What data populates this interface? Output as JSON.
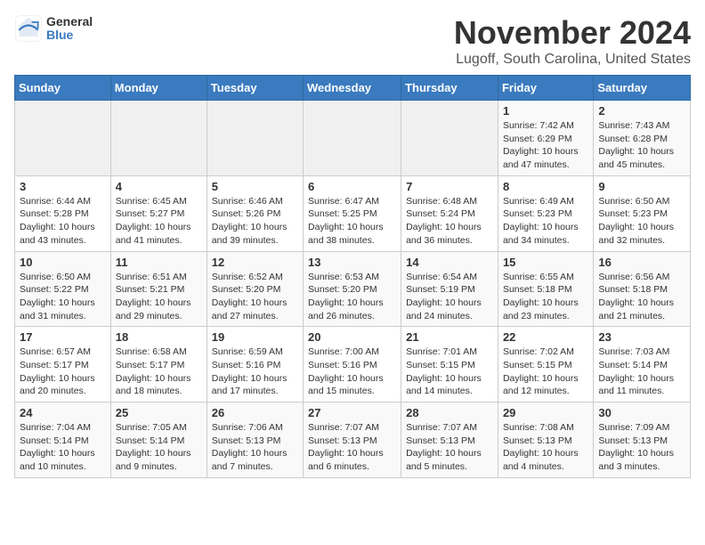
{
  "header": {
    "logo_general": "General",
    "logo_blue": "Blue",
    "title": "November 2024",
    "location": "Lugoff, South Carolina, United States"
  },
  "days_of_week": [
    "Sunday",
    "Monday",
    "Tuesday",
    "Wednesday",
    "Thursday",
    "Friday",
    "Saturday"
  ],
  "weeks": [
    [
      {
        "day": "",
        "info": ""
      },
      {
        "day": "",
        "info": ""
      },
      {
        "day": "",
        "info": ""
      },
      {
        "day": "",
        "info": ""
      },
      {
        "day": "",
        "info": ""
      },
      {
        "day": "1",
        "info": "Sunrise: 7:42 AM\nSunset: 6:29 PM\nDaylight: 10 hours\nand 47 minutes."
      },
      {
        "day": "2",
        "info": "Sunrise: 7:43 AM\nSunset: 6:28 PM\nDaylight: 10 hours\nand 45 minutes."
      }
    ],
    [
      {
        "day": "3",
        "info": "Sunrise: 6:44 AM\nSunset: 5:28 PM\nDaylight: 10 hours\nand 43 minutes."
      },
      {
        "day": "4",
        "info": "Sunrise: 6:45 AM\nSunset: 5:27 PM\nDaylight: 10 hours\nand 41 minutes."
      },
      {
        "day": "5",
        "info": "Sunrise: 6:46 AM\nSunset: 5:26 PM\nDaylight: 10 hours\nand 39 minutes."
      },
      {
        "day": "6",
        "info": "Sunrise: 6:47 AM\nSunset: 5:25 PM\nDaylight: 10 hours\nand 38 minutes."
      },
      {
        "day": "7",
        "info": "Sunrise: 6:48 AM\nSunset: 5:24 PM\nDaylight: 10 hours\nand 36 minutes."
      },
      {
        "day": "8",
        "info": "Sunrise: 6:49 AM\nSunset: 5:23 PM\nDaylight: 10 hours\nand 34 minutes."
      },
      {
        "day": "9",
        "info": "Sunrise: 6:50 AM\nSunset: 5:23 PM\nDaylight: 10 hours\nand 32 minutes."
      }
    ],
    [
      {
        "day": "10",
        "info": "Sunrise: 6:50 AM\nSunset: 5:22 PM\nDaylight: 10 hours\nand 31 minutes."
      },
      {
        "day": "11",
        "info": "Sunrise: 6:51 AM\nSunset: 5:21 PM\nDaylight: 10 hours\nand 29 minutes."
      },
      {
        "day": "12",
        "info": "Sunrise: 6:52 AM\nSunset: 5:20 PM\nDaylight: 10 hours\nand 27 minutes."
      },
      {
        "day": "13",
        "info": "Sunrise: 6:53 AM\nSunset: 5:20 PM\nDaylight: 10 hours\nand 26 minutes."
      },
      {
        "day": "14",
        "info": "Sunrise: 6:54 AM\nSunset: 5:19 PM\nDaylight: 10 hours\nand 24 minutes."
      },
      {
        "day": "15",
        "info": "Sunrise: 6:55 AM\nSunset: 5:18 PM\nDaylight: 10 hours\nand 23 minutes."
      },
      {
        "day": "16",
        "info": "Sunrise: 6:56 AM\nSunset: 5:18 PM\nDaylight: 10 hours\nand 21 minutes."
      }
    ],
    [
      {
        "day": "17",
        "info": "Sunrise: 6:57 AM\nSunset: 5:17 PM\nDaylight: 10 hours\nand 20 minutes."
      },
      {
        "day": "18",
        "info": "Sunrise: 6:58 AM\nSunset: 5:17 PM\nDaylight: 10 hours\nand 18 minutes."
      },
      {
        "day": "19",
        "info": "Sunrise: 6:59 AM\nSunset: 5:16 PM\nDaylight: 10 hours\nand 17 minutes."
      },
      {
        "day": "20",
        "info": "Sunrise: 7:00 AM\nSunset: 5:16 PM\nDaylight: 10 hours\nand 15 minutes."
      },
      {
        "day": "21",
        "info": "Sunrise: 7:01 AM\nSunset: 5:15 PM\nDaylight: 10 hours\nand 14 minutes."
      },
      {
        "day": "22",
        "info": "Sunrise: 7:02 AM\nSunset: 5:15 PM\nDaylight: 10 hours\nand 12 minutes."
      },
      {
        "day": "23",
        "info": "Sunrise: 7:03 AM\nSunset: 5:14 PM\nDaylight: 10 hours\nand 11 minutes."
      }
    ],
    [
      {
        "day": "24",
        "info": "Sunrise: 7:04 AM\nSunset: 5:14 PM\nDaylight: 10 hours\nand 10 minutes."
      },
      {
        "day": "25",
        "info": "Sunrise: 7:05 AM\nSunset: 5:14 PM\nDaylight: 10 hours\nand 9 minutes."
      },
      {
        "day": "26",
        "info": "Sunrise: 7:06 AM\nSunset: 5:13 PM\nDaylight: 10 hours\nand 7 minutes."
      },
      {
        "day": "27",
        "info": "Sunrise: 7:07 AM\nSunset: 5:13 PM\nDaylight: 10 hours\nand 6 minutes."
      },
      {
        "day": "28",
        "info": "Sunrise: 7:07 AM\nSunset: 5:13 PM\nDaylight: 10 hours\nand 5 minutes."
      },
      {
        "day": "29",
        "info": "Sunrise: 7:08 AM\nSunset: 5:13 PM\nDaylight: 10 hours\nand 4 minutes."
      },
      {
        "day": "30",
        "info": "Sunrise: 7:09 AM\nSunset: 5:13 PM\nDaylight: 10 hours\nand 3 minutes."
      }
    ]
  ]
}
